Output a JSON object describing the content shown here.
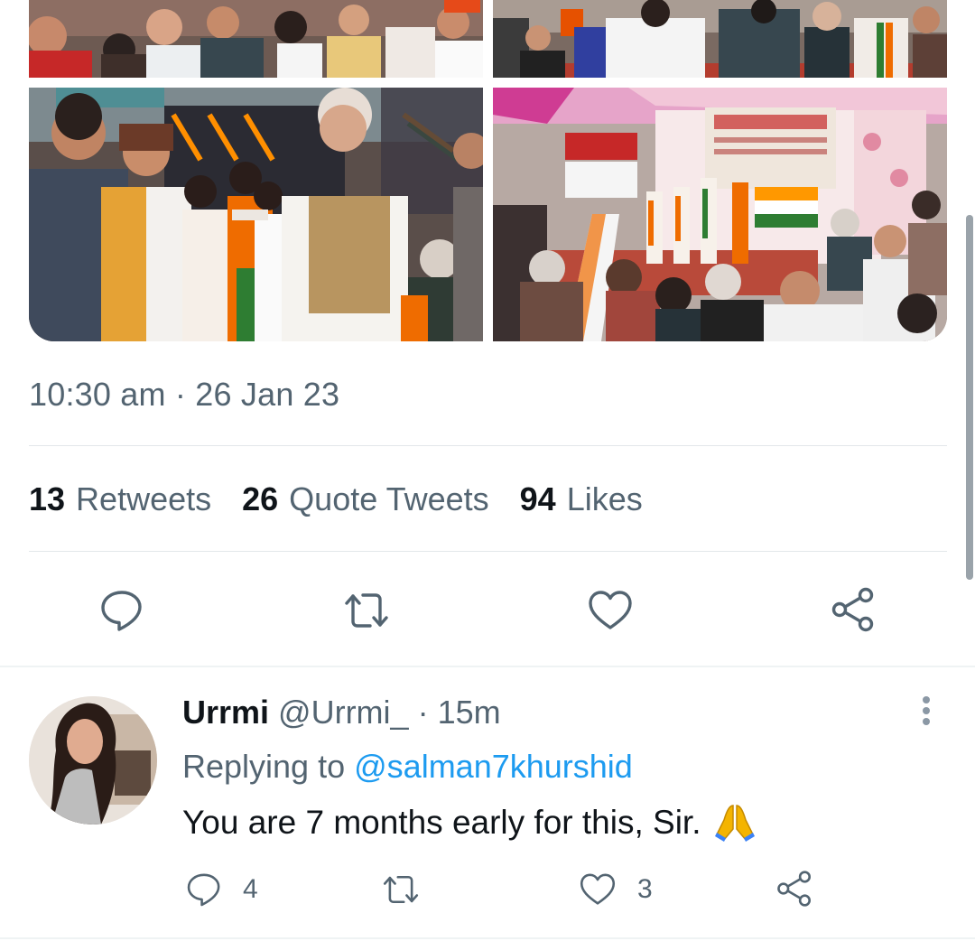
{
  "tweet": {
    "timestamp": "10:30 am · 26 Jan 23",
    "stats": {
      "retweets": {
        "count": "13",
        "label": "Retweets"
      },
      "quote_tweets": {
        "count": "26",
        "label": "Quote Tweets"
      },
      "likes": {
        "count": "94",
        "label": "Likes"
      }
    },
    "photos": [
      {
        "icon": "photo-crowd-flags"
      },
      {
        "icon": "photo-crowd-ceremony"
      },
      {
        "icon": "photo-felicitation"
      },
      {
        "icon": "photo-stage-performance"
      }
    ],
    "actions": [
      "reply-icon",
      "retweet-icon",
      "like-icon",
      "share-icon"
    ]
  },
  "reply": {
    "name": "Urrmi",
    "handle": "@Urrmi_",
    "separator": "·",
    "time": "15m",
    "replying_prefix": "Replying to",
    "replying_to": "@salman7khurshid",
    "text": "You are 7 months early for this, Sir.",
    "emoji_icon": "folded-hands-icon",
    "reply_count": "4",
    "retweet_count": "",
    "like_count": "3"
  },
  "colors": {
    "primary_text": "#0f1419",
    "secondary_text": "#536471",
    "link": "#1d9bf0",
    "divider": "#eff3f4"
  }
}
